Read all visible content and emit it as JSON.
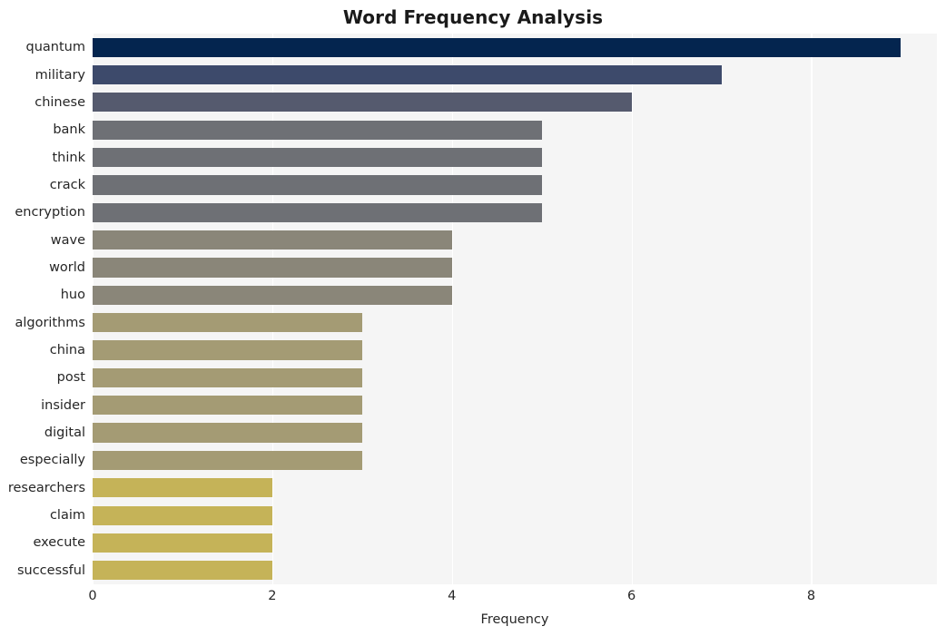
{
  "chart_data": {
    "type": "bar",
    "orientation": "horizontal",
    "title": "Word Frequency Analysis",
    "xlabel": "Frequency",
    "ylabel": "",
    "categories": [
      "quantum",
      "military",
      "chinese",
      "bank",
      "think",
      "crack",
      "encryption",
      "wave",
      "world",
      "huo",
      "algorithms",
      "china",
      "post",
      "insider",
      "digital",
      "especially",
      "researchers",
      "claim",
      "execute",
      "successful"
    ],
    "values": [
      9,
      7,
      6,
      5,
      5,
      5,
      5,
      4,
      4,
      4,
      3,
      3,
      3,
      3,
      3,
      3,
      2,
      2,
      2,
      2
    ],
    "xlim": [
      0,
      9.4
    ],
    "xticks": [
      0,
      2,
      4,
      6,
      8
    ],
    "xtick_labels": [
      "0",
      "2",
      "4",
      "6",
      "8"
    ],
    "grid": "vertical-white-on-gray",
    "legend": "none",
    "bar_colors": [
      "#04254f",
      "#3d4a6b",
      "#555a6e",
      "#6e7075",
      "#6e7075",
      "#6e7075",
      "#6e7075",
      "#8a8679",
      "#8a8679",
      "#8a8679",
      "#a49b74",
      "#a49b74",
      "#a49b74",
      "#a49b74",
      "#a49b74",
      "#a49b74",
      "#c5b358",
      "#c5b358",
      "#c5b358",
      "#c5b358"
    ],
    "plot_background": "#f5f5f5",
    "figure_background": "#ffffff",
    "gridline_color": "#ffffff",
    "text_color": "#262626"
  }
}
